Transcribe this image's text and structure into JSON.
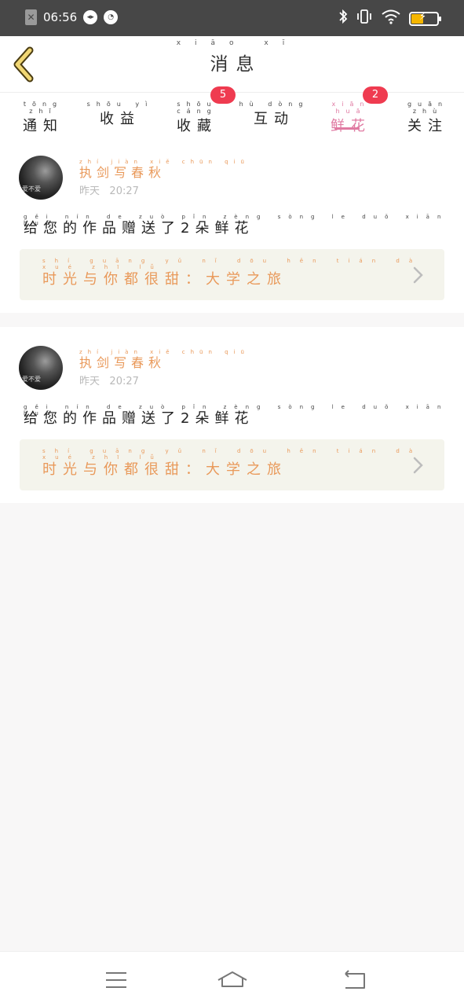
{
  "status_bar": {
    "time": "06:56",
    "battery_color": "#f5b600",
    "icons": [
      "sim-off-icon",
      "wechat-icon",
      "speed-icon",
      "bluetooth-icon",
      "vibrate-icon",
      "wifi-icon",
      "battery-icon"
    ]
  },
  "header": {
    "title": "消息",
    "title_pinyin": "xiāo xī",
    "back_icon": "back-chevron-icon",
    "accent_color": "#e07aa2"
  },
  "tabs": [
    {
      "label": "通知",
      "pinyin": "tōng zhī",
      "badge": ""
    },
    {
      "label": "收益",
      "pinyin": "shōu yì",
      "badge": ""
    },
    {
      "label": "收藏",
      "pinyin": "shōu cáng",
      "badge": "5"
    },
    {
      "label": "互动",
      "pinyin": "hù dòng",
      "badge": ""
    },
    {
      "label": "鲜花",
      "pinyin": "xiān huā",
      "badge": "2",
      "active": true
    },
    {
      "label": "关注",
      "pinyin": "guān zhù",
      "badge": ""
    }
  ],
  "messages": [
    {
      "user": "执剑写春秋",
      "user_pinyin": "zhí jiàn xiě chūn qiū",
      "avatar_caption": "爱不爱",
      "date_label": "昨天",
      "time": "20:27",
      "text": "给您的作品赠送了2朵鲜花",
      "text_pinyin": "gěi nín de zuò pǐn zèng sòng le duǒ xiān huā",
      "work_title": "时光与你都很甜：大学之旅",
      "work_pinyin": "shí guāng yǔ nǐ dōu hěn tián dà xué zhī lǚ"
    },
    {
      "user": "执剑写春秋",
      "user_pinyin": "zhí jiàn xiě chūn qiū",
      "avatar_caption": "爱不爱",
      "date_label": "昨天",
      "time": "20:27",
      "text": "给您的作品赠送了2朵鲜花",
      "text_pinyin": "gěi nín de zuò pǐn zèng sòng le duǒ xiān huā",
      "work_title": "时光与你都很甜：大学之旅",
      "work_pinyin": "shí guāng yǔ nǐ dōu hěn tián dà xué zhī lǚ"
    }
  ],
  "nav": {
    "icons": [
      "menu-icon",
      "home-icon",
      "back-icon"
    ]
  }
}
